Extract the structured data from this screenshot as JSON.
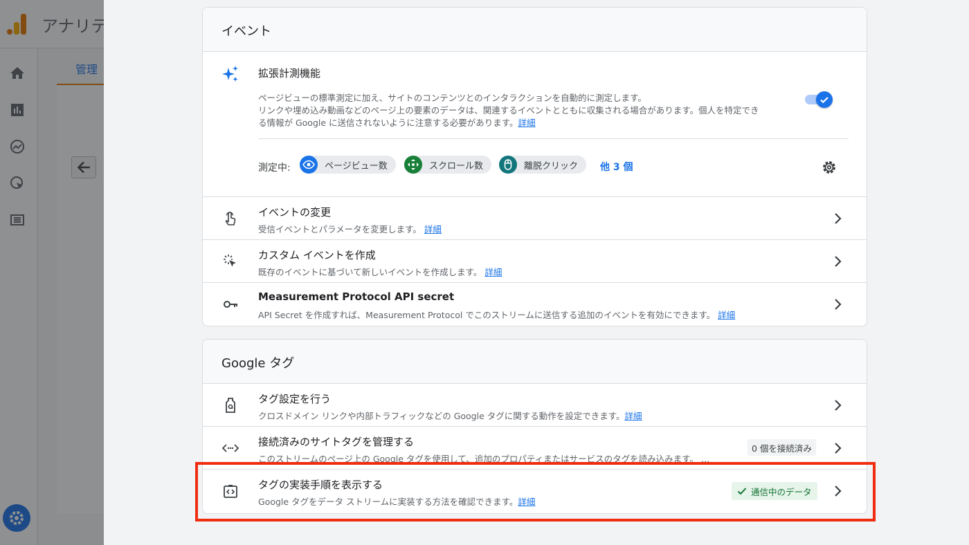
{
  "background": {
    "app_title": "アナリテ",
    "tab_label": "管理"
  },
  "events_card": {
    "header": "イベント",
    "enhanced": {
      "title": "拡張計測機能",
      "desc_line1": "ページビューの標準測定に加え、サイトのコンテンツとのインタラクションを自動的に測定します。",
      "desc_line2": "リンクや埋め込み動画などのページ上の要素のデータは、関連するイベントとともに収集される場合があります。個人を特定でき",
      "desc_line3": "る情報が Google に送信されないように注意する必要があります。",
      "link": "詳細",
      "toggle_on": true,
      "measuring_label": "測定中:",
      "chips": [
        {
          "label": "ページビュー数",
          "icon": "eye-icon",
          "color": "#1a73e8"
        },
        {
          "label": "スクロール数",
          "icon": "scroll-icon",
          "color": "#188038"
        },
        {
          "label": "離脱クリック",
          "icon": "mouse-icon",
          "color": "#12767c"
        }
      ],
      "more": "他 3 個"
    },
    "rows": [
      {
        "title": "イベントの変更",
        "desc": "受信イベントとパラメータを変更します。",
        "link": "詳細",
        "icon": "touch-icon"
      },
      {
        "title": "カスタム イベントを作成",
        "desc": "既存のイベントに基づいて新しいイベントを作成します。",
        "link": "詳細",
        "icon": "sparkle-cursor-icon"
      },
      {
        "title": "Measurement Protocol API secret",
        "desc": "API Secret を作成すれば、Measurement Protocol でこのストリームに送信する追加のイベントを有効にできます。",
        "link": "詳細",
        "icon": "key-icon"
      }
    ]
  },
  "tag_card": {
    "header": "Google タグ",
    "rows": [
      {
        "title": "タグ設定を行う",
        "desc": "クロスドメイン リンクや内部トラフィックなどの Google タグに関する動作を設定できます。",
        "link": "詳細",
        "icon": "tag-icon"
      },
      {
        "title": "接続済みのサイトタグを管理する",
        "desc": "このストリームのページ上の Google タグを使用して、追加のプロパティまたはサービスのタグを読み込みます。 …",
        "badge": "0 個を接続済み",
        "icon": "code-arrows-icon"
      },
      {
        "title": "タグの実装手順を表示する",
        "desc": "Google タグをデータ ストリームに実装する方法を確認できます。",
        "link": "詳細",
        "status": "通信中のデータ",
        "icon": "code-clipboard-icon"
      }
    ]
  },
  "colors": {
    "accent": "#1a73e8",
    "highlight": "#f02c0f",
    "status_green": "#137333"
  }
}
